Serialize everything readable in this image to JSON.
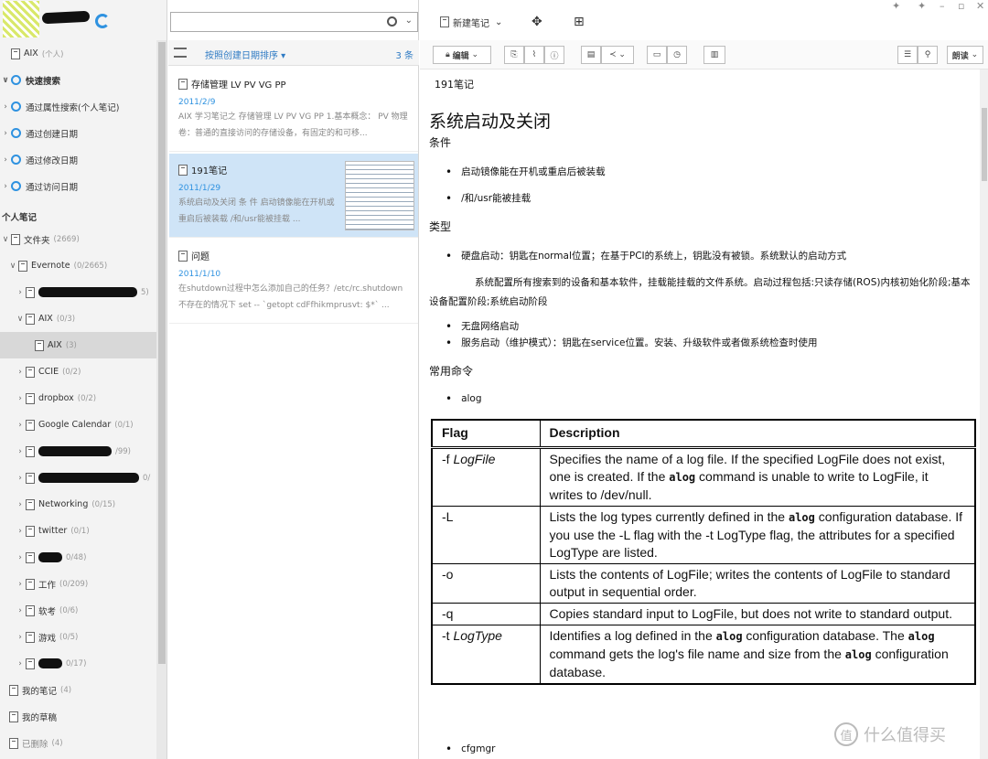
{
  "search": {
    "placeholder": ""
  },
  "toolbar": {
    "new_note": "新建笔记"
  },
  "sidebar": {
    "aix_personal": {
      "label": "AIX",
      "count": "(个人)"
    },
    "quick_search": "快速搜索",
    "qs_items": [
      "通过属性搜索(个人笔记)",
      "通过创建日期",
      "通过修改日期",
      "通过访问日期"
    ],
    "personal_notes": "个人笔记",
    "folder": {
      "label": "文件夹",
      "count": "(2669)"
    },
    "evernote": {
      "label": "Evernote",
      "count": "(0/2665)"
    },
    "redacted1_count": "5)",
    "aix_nb": {
      "label": "AIX",
      "count": "(0/3)"
    },
    "aix_sub": {
      "label": "AIX",
      "count": "(3)"
    },
    "ccie": {
      "label": "CCIE",
      "count": "(0/2)"
    },
    "dropbox": {
      "label": "dropbox",
      "count": "(0/2)"
    },
    "gcal": {
      "label": "Google Calendar",
      "count": "(0/1)"
    },
    "redacted2_count": "/99)",
    "redacted3_count": "0/",
    "networking": {
      "label": "Networking",
      "count": "(0/15)"
    },
    "twitter": {
      "label": "twitter",
      "count": "(0/1)"
    },
    "redacted4_count": "0/48)",
    "work": {
      "label": "工作",
      "count": "(0/209)"
    },
    "exam": {
      "label": "软考",
      "count": "(0/6)"
    },
    "game": {
      "label": "游戏",
      "count": "(0/5)"
    },
    "redacted5_count": "0/17)",
    "my_notes": {
      "label": "我的笔记",
      "count": "(4)"
    },
    "drafts": {
      "label": "我的草稿",
      "count": ""
    },
    "deleted": {
      "label": "已删除",
      "count": "(4)"
    }
  },
  "list": {
    "sort_label": "按照创建日期排序",
    "count": "3 条",
    "notes": [
      {
        "title": "存储管理 LV PV VG PP",
        "date": "2011/2/9",
        "snippet": "AIX 学习笔记之 存储管理 LV PV VG PP 1.基本概念： PV 物理卷：普通的直接访问的存储设备，有固定的和可移..."
      },
      {
        "title": "191笔记",
        "date": "2011/1/29",
        "snippet": "系统启动及关闭 条 件 启动镜像能在开机或重启后被装载 /和/usr能被挂载 ..."
      },
      {
        "title": "问题",
        "date": "2011/1/10",
        "snippet": "在shutdown过程中怎么添加自己的任务？/etc/rc.shutdown不存在的情况下 set -- `getopt cdFfhikmprusvt: $*` ..."
      }
    ]
  },
  "editor": {
    "edit": "编辑",
    "read_aloud": "朗读"
  },
  "doc": {
    "note_title": "191笔记",
    "heading": "系统启动及关闭",
    "s1": "条件",
    "b1": "启动镜像能在开机或重启后被装载",
    "b2": "/和/usr能被挂载",
    "s2": "类型",
    "b3": "硬盘启动：钥匙在normal位置；在基于PCI的系统上，钥匙没有被锁。系统默认的启动方式",
    "p1": "系统配置所有搜索到的设备和基本软件，挂载能挂载的文件系统。启动过程包括:只读存储(ROS)内核初始化阶段;基本设备配置阶段;系统启动阶段",
    "b4": "无盘网络启动",
    "b5": "服务启动（维护模式）：钥匙在service位置。安装、升级软件或者做系统检查时使用",
    "s3": "常用命令",
    "b6": "alog",
    "th_flag": "Flag",
    "th_desc": "Description",
    "b7": "cfgmgr"
  },
  "watermark": "什么值得买"
}
